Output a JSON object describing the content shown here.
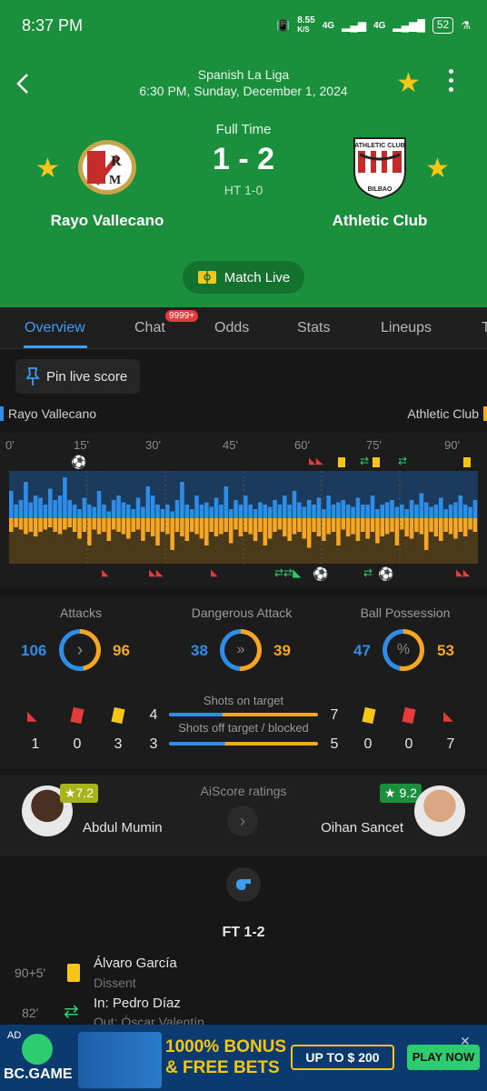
{
  "status_bar": {
    "time": "8:37 PM",
    "speed": "8.55",
    "speed_unit": "K/S",
    "net1": "4G",
    "net2": "4G",
    "battery": "52"
  },
  "match": {
    "league": "Spanish La Liga",
    "datetime": "6:30 PM, Sunday, December 1, 2024",
    "status": "Full Time",
    "score": "1 - 2",
    "ht": "HT 1-0",
    "home": "Rayo Vallecano",
    "away": "Athletic Club",
    "live_label": "Match Live"
  },
  "tabs": [
    {
      "label": "Overview"
    },
    {
      "label": "Chat"
    },
    {
      "label": "Odds"
    },
    {
      "label": "Stats"
    },
    {
      "label": "Lineups"
    },
    {
      "label": "T"
    }
  ],
  "chat_badge": "9999+",
  "pin_label": "Pin live score",
  "timeline": {
    "home": "Rayo Vallecano",
    "away": "Athletic Club",
    "minutes": [
      "0'",
      "15'",
      "30'",
      "45'",
      "60'",
      "75'",
      "90'"
    ]
  },
  "stats": {
    "attacks": {
      "label": "Attacks",
      "home": "106",
      "away": "96"
    },
    "dangerous": {
      "label": "Dangerous Attack",
      "home": "38",
      "away": "39"
    },
    "possession": {
      "label": "Ball Possession",
      "home": "47",
      "away": "53"
    },
    "shots_on": {
      "label": "Shots on target",
      "home": "4",
      "away": "7"
    },
    "shots_off": {
      "label": "Shots off target / blocked",
      "home": "3",
      "away": "5"
    },
    "home_counts": {
      "corners": "1",
      "red": "0",
      "yellow": "3"
    },
    "away_counts": {
      "yellow": "0",
      "red": "0",
      "corners": "7"
    }
  },
  "ratings": {
    "title": "AiScore ratings",
    "home_player": "Abdul Mumin",
    "home_rating": "★7.2",
    "away_player": "Oihan Sancet",
    "away_rating": "★ 9.2"
  },
  "events": {
    "ft": "FT 1-2",
    "e1": {
      "minute": "90+5'",
      "player": "Álvaro García",
      "detail": "Dissent"
    },
    "e2": {
      "minute": "82'",
      "player": "In: Pedro Díaz",
      "detail": "Out: Óscar Valentín"
    }
  },
  "ad": {
    "label": "AD",
    "brand": "BC.GAME",
    "line1": "1000% BONUS",
    "line2": "& FREE BETS",
    "offer": "UP TO $ 200",
    "cta": "PLAY NOW"
  },
  "colors": {
    "header_green": "#1a8f3c",
    "home_blue": "#2e8de6",
    "away_orange": "#f5a623"
  },
  "chart_data": {
    "type": "bar",
    "home_attack_momentum": [
      0.6,
      0.3,
      0.4,
      0.8,
      0.35,
      0.5,
      0.45,
      0.3,
      0.65,
      0.4,
      0.5,
      0.9,
      0.4,
      0.3,
      0.2,
      0.45,
      0.3,
      0.25,
      0.6,
      0.3,
      0.15,
      0.4,
      0.5,
      0.35,
      0.3,
      0.2,
      0.45,
      0.25,
      0.7,
      0.5,
      0.3,
      0.2,
      0.3,
      0.15,
      0.4,
      0.8,
      0.3,
      0.2,
      0.5,
      0.3,
      0.35,
      0.25,
      0.45,
      0.3,
      0.7,
      0.2,
      0.4,
      0.3,
      0.5,
      0.3,
      0.2,
      0.35,
      0.3,
      0.25,
      0.4,
      0.3,
      0.5,
      0.3,
      0.6,
      0.35,
      0.25,
      0.4,
      0.3,
      0.45,
      0.2,
      0.5,
      0.3,
      0.35,
      0.4,
      0.3,
      0.25,
      0.45,
      0.3,
      0.3,
      0.5,
      0.2,
      0.3,
      0.35,
      0.4,
      0.25,
      0.3,
      0.2,
      0.4,
      0.3,
      0.55,
      0.35,
      0.25,
      0.3,
      0.45,
      0.2,
      0.3,
      0.35,
      0.5,
      0.3,
      0.25,
      0.4
    ],
    "away_attack_momentum": [
      0.3,
      0.2,
      0.25,
      0.35,
      0.3,
      0.4,
      0.3,
      0.25,
      0.2,
      0.3,
      0.35,
      0.25,
      0.2,
      0.3,
      0.45,
      0.3,
      0.6,
      0.25,
      0.35,
      0.3,
      0.5,
      0.25,
      0.3,
      0.35,
      0.45,
      0.3,
      0.25,
      0.5,
      0.3,
      0.4,
      0.6,
      0.3,
      0.35,
      0.7,
      0.3,
      0.4,
      0.5,
      0.3,
      0.35,
      0.45,
      0.6,
      0.3,
      0.4,
      0.35,
      0.3,
      0.55,
      0.25,
      0.4,
      0.3,
      0.35,
      0.5,
      0.3,
      0.6,
      0.45,
      0.3,
      0.25,
      0.4,
      0.5,
      0.35,
      0.3,
      0.45,
      0.65,
      0.3,
      0.4,
      0.5,
      0.35,
      0.3,
      0.6,
      0.25,
      0.4,
      0.35,
      0.5,
      0.3,
      0.45,
      0.3,
      0.55,
      0.4,
      0.35,
      0.3,
      0.6,
      0.25,
      0.4,
      0.45,
      0.3,
      0.35,
      0.7,
      0.3,
      0.4,
      0.5,
      0.3,
      0.35,
      0.45,
      0.3,
      0.4,
      0.25,
      0.3
    ]
  }
}
